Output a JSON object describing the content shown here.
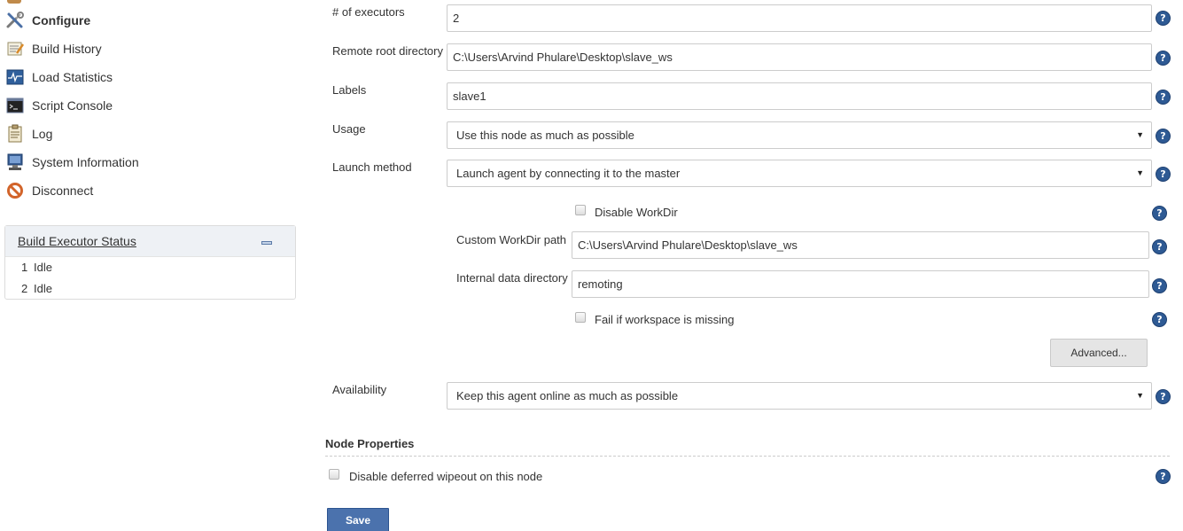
{
  "sidebar": {
    "items": [
      {
        "label": "Configure",
        "icon": "configure-icon"
      },
      {
        "label": "Build History",
        "icon": "build-history-icon"
      },
      {
        "label": "Load Statistics",
        "icon": "load-statistics-icon"
      },
      {
        "label": "Script Console",
        "icon": "script-console-icon"
      },
      {
        "label": "Log",
        "icon": "log-icon"
      },
      {
        "label": "System Information",
        "icon": "system-information-icon"
      },
      {
        "label": "Disconnect",
        "icon": "disconnect-icon"
      }
    ],
    "executor_panel": {
      "title": "Build Executor Status",
      "executors": [
        {
          "number": "1",
          "status": "Idle"
        },
        {
          "number": "2",
          "status": "Idle"
        }
      ]
    }
  },
  "form": {
    "executors": {
      "label": "# of executors",
      "value": "2"
    },
    "remote_root": {
      "label": "Remote root directory",
      "value": "C:\\Users\\Arvind Phulare\\Desktop\\slave_ws"
    },
    "labels": {
      "label": "Labels",
      "value": "slave1"
    },
    "usage": {
      "label": "Usage",
      "selected": "Use this node as much as possible"
    },
    "launch_method": {
      "label": "Launch method",
      "selected": "Launch agent by connecting it to the master"
    },
    "disable_workdir": {
      "label": "Disable WorkDir",
      "checked": false
    },
    "custom_workdir": {
      "label": "Custom WorkDir path",
      "value": "C:\\Users\\Arvind Phulare\\Desktop\\slave_ws"
    },
    "internal_data_dir": {
      "label": "Internal data directory",
      "value": "remoting"
    },
    "fail_if_missing": {
      "label": "Fail if workspace is missing",
      "checked": false
    },
    "advanced_label": "Advanced...",
    "availability": {
      "label": "Availability",
      "selected": "Keep this agent online as much as possible"
    },
    "node_properties": {
      "title": "Node Properties",
      "disable_wipeout": {
        "label": "Disable deferred wipeout on this node",
        "checked": false
      }
    },
    "save_label": "Save",
    "help_glyph": "?"
  },
  "colors": {
    "help_icon": "#2e5a94",
    "save_button": "#4b72ad",
    "panel_header": "#eef1f5"
  }
}
